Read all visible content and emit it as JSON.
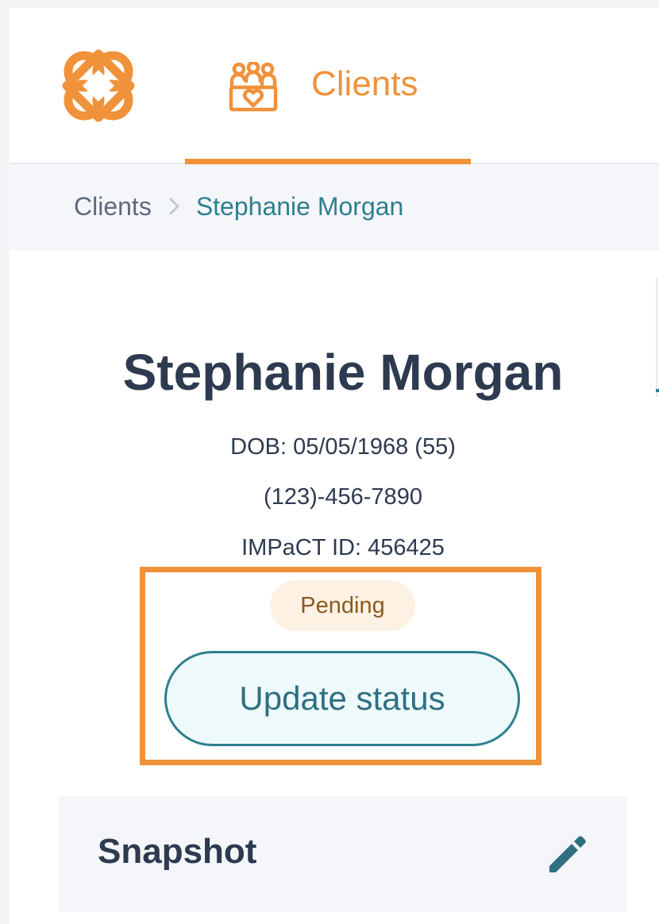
{
  "nav": {
    "logo_icon": "brand-logo-icon",
    "tab_icon": "clients-group-icon",
    "tab_label": "Clients",
    "accent_color": "#f0923a"
  },
  "breadcrumb": {
    "root": "Clients",
    "separator_icon": "chevron-right-icon",
    "current": "Stephanie Morgan"
  },
  "client": {
    "name": "Stephanie Morgan",
    "dob": "DOB: 05/05/1968 (55)",
    "phone": "(123)-456-7890",
    "impact_id": "IMPaCT ID: 456425",
    "status": "Pending",
    "update_button_label": "Update status"
  },
  "snapshot": {
    "title": "Snapshot",
    "edit_icon": "pencil-icon"
  },
  "colors": {
    "accent": "#f0923a",
    "teal": "#2f7f8e",
    "text_dark": "#2d3a4f",
    "pending_bg": "#fdf1e4",
    "pending_text": "#8a5a1e"
  }
}
